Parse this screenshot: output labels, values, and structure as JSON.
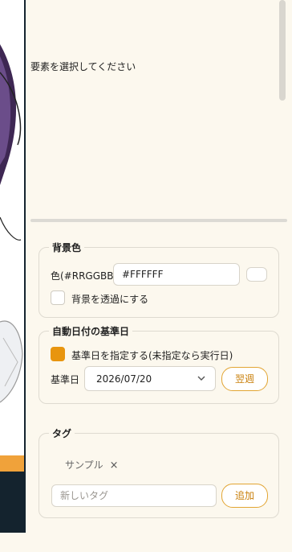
{
  "props": {
    "placeholder": "要素を選択してください"
  },
  "background": {
    "title": "背景色",
    "color_label": "色(#RRGGBB)",
    "color_value": "#FFFFFF",
    "transparent_label": "背景を透過にする",
    "transparent_checked": false
  },
  "date": {
    "title": "自動日付の基準日",
    "specify_label": "基準日を指定する(未指定なら実行日)",
    "specify_checked": true,
    "base_label": "基準日",
    "base_value": "2026/07/20",
    "next_week_button": "翌週"
  },
  "tags": {
    "title": "タグ",
    "items": [
      "サンプル"
    ],
    "remove_glyph": "×",
    "new_tag_placeholder": "新しいタグ",
    "add_button": "追加"
  }
}
